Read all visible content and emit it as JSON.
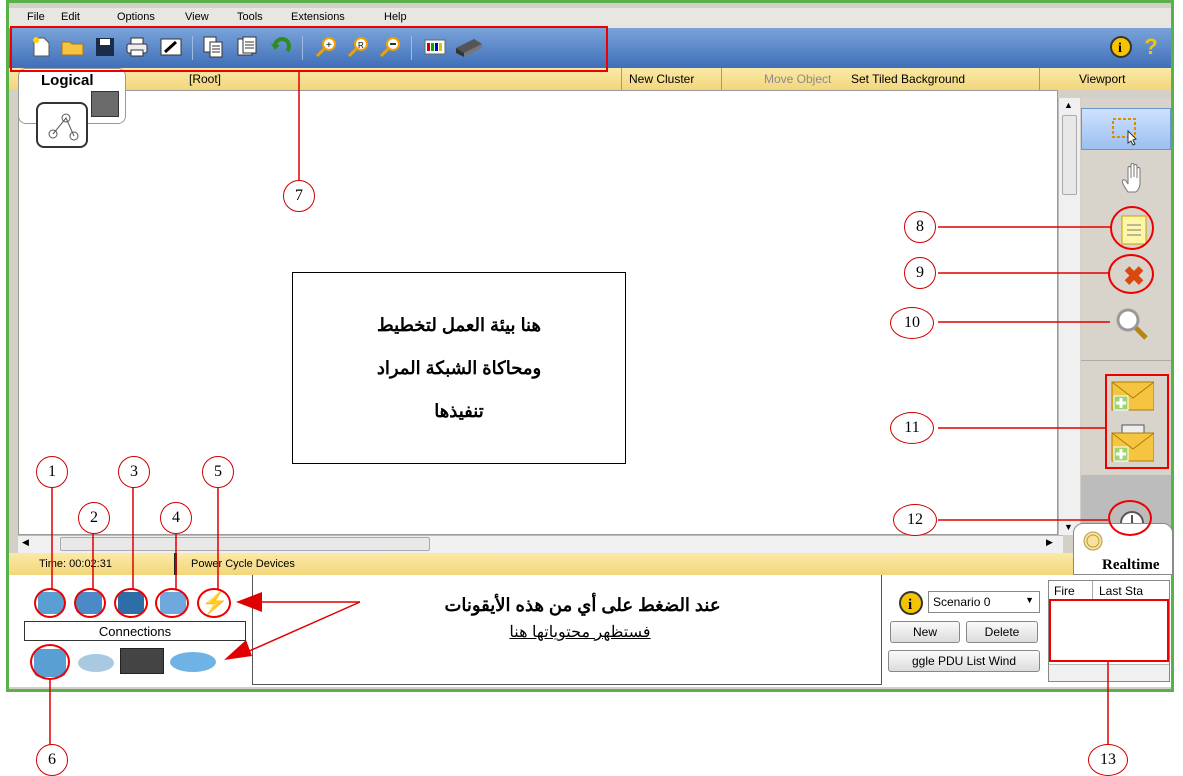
{
  "menu": [
    "File",
    "Edit",
    "Options",
    "View",
    "Tools",
    "Extensions",
    "Help"
  ],
  "logical_bar": {
    "tab_label": "Logical",
    "root": "[Root]",
    "new_cluster": "New Cluster",
    "move_object": "Move Object",
    "set_tiled_background": "Set Tiled Background",
    "viewport": "Viewport"
  },
  "workspace": {
    "note_lines": [
      "هنا بيئة العمل لتخطيط",
      "ومحاكاة الشبكة المراد",
      "تنفيذها"
    ]
  },
  "statusbar": {
    "time": "Time: 00:02:31",
    "power_cycle": "Power Cycle Devices",
    "mode": "Realtime"
  },
  "bottom": {
    "connections_label": "Connections",
    "hint_line1": "عند الضغط على أي من هذه الأيقونات",
    "hint_line2": "فستظهر محتوياتها هنا",
    "scenario_value": "Scenario 0",
    "new_button": "New",
    "delete_button": "Delete",
    "toggle_pdu_button": "ggle PDU List Wind",
    "pdu_columns": [
      "Fire",
      "Last Sta"
    ]
  },
  "callouts": [
    "1",
    "2",
    "3",
    "4",
    "5",
    "6",
    "7",
    "8",
    "9",
    "10",
    "11",
    "12",
    "13"
  ],
  "colors": {
    "frame": "#58b14a",
    "toolbar": "#4a7cc4",
    "bar": "#f5dd8a",
    "annotation": "#e00000"
  }
}
